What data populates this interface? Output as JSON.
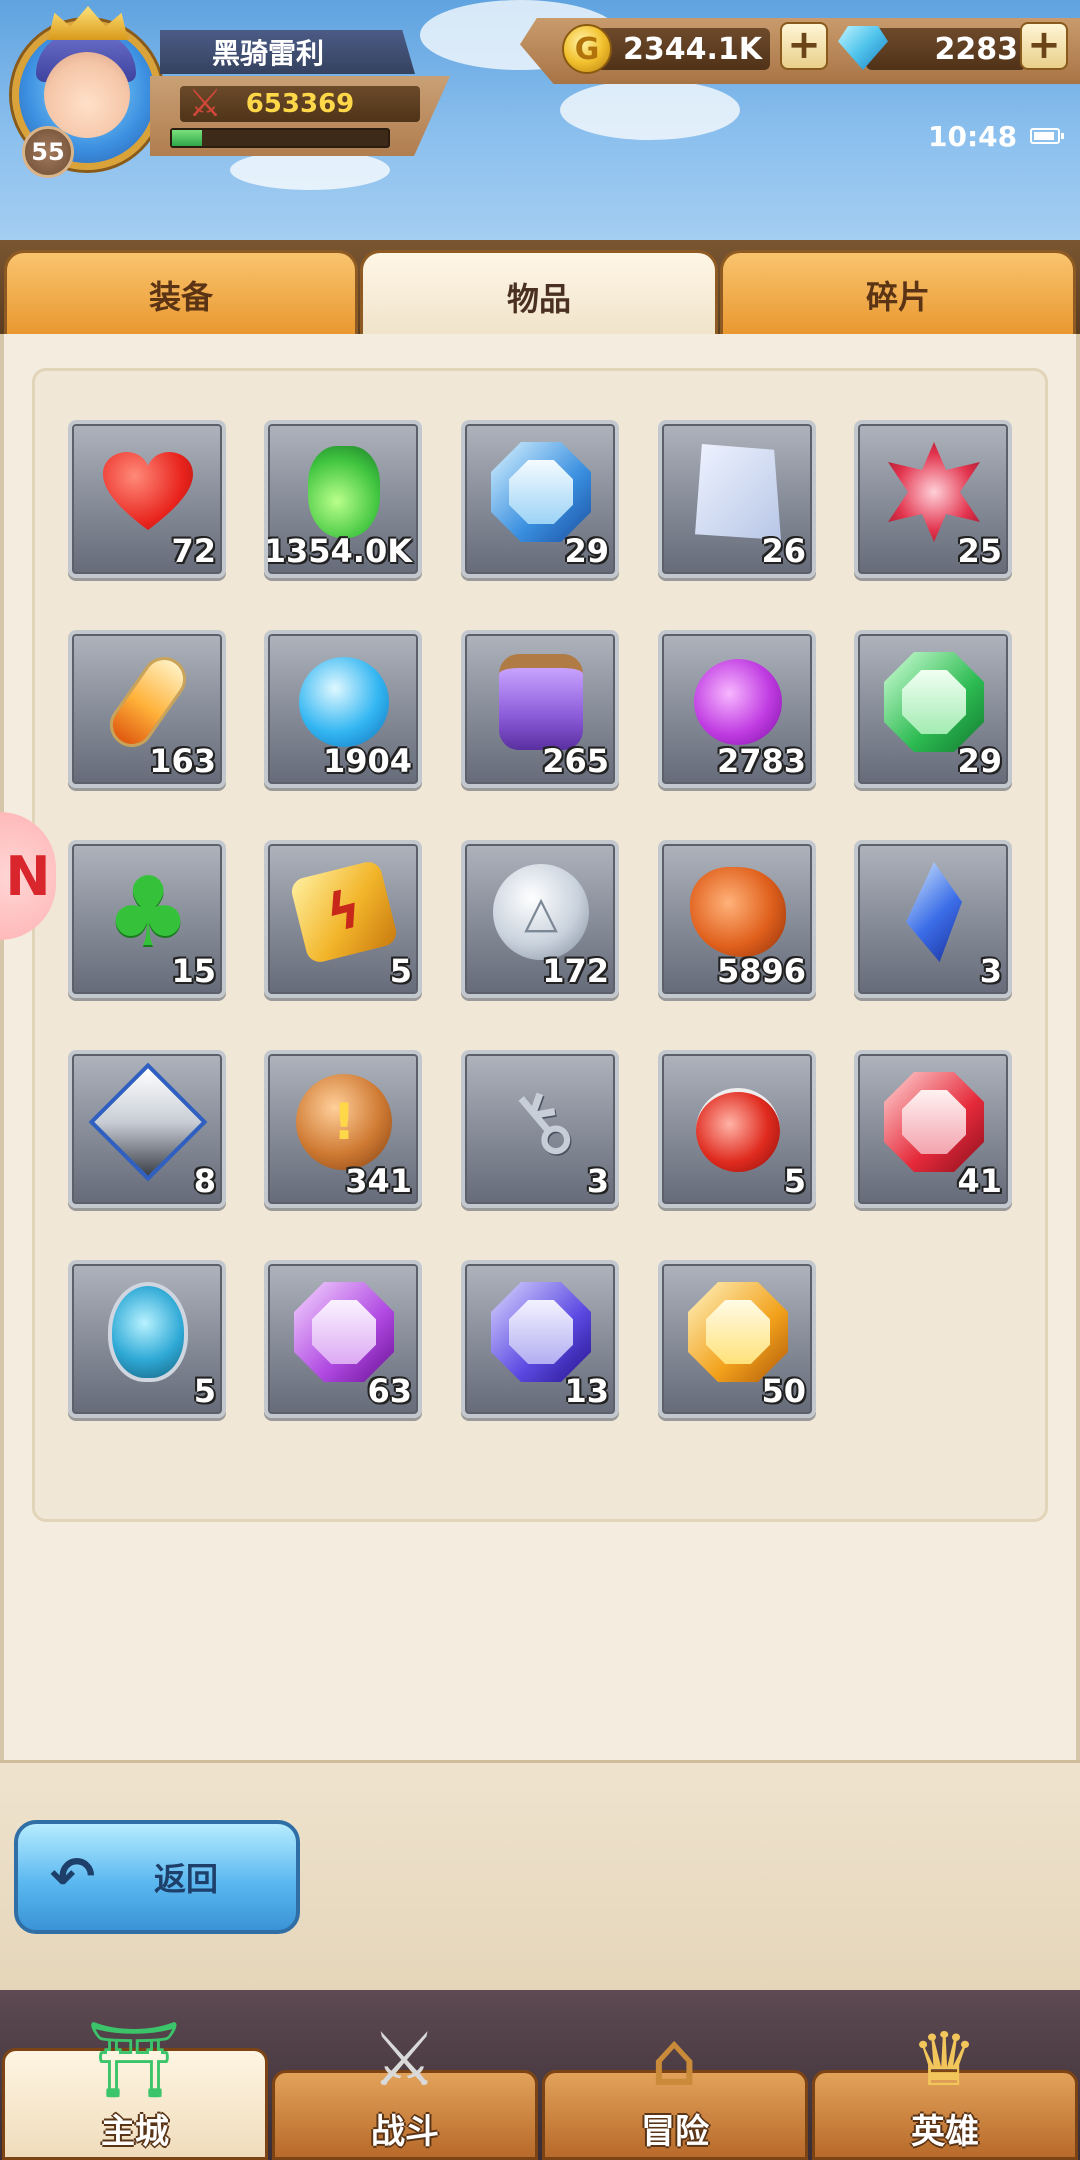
{
  "player": {
    "name": "黑骑雷利",
    "level": "55",
    "power": "653369",
    "exp_progress": 0.14
  },
  "resources": {
    "gold": "2344.1K",
    "gems": "2283"
  },
  "status_bar": {
    "time": "10:48"
  },
  "tabs": [
    {
      "label": "装备",
      "active": false
    },
    {
      "label": "物品",
      "active": true
    },
    {
      "label": "碎片",
      "active": false
    }
  ],
  "items": [
    {
      "icon": "heart-icon",
      "count": "72"
    },
    {
      "icon": "green-potion-icon",
      "count": "1354.0K"
    },
    {
      "icon": "blue-shield-gem-icon",
      "count": "29"
    },
    {
      "icon": "scroll-icon",
      "count": "26"
    },
    {
      "icon": "red-star-gem-icon",
      "count": "25"
    },
    {
      "icon": "orange-vial-icon",
      "count": "163"
    },
    {
      "icon": "blue-orb-icon",
      "count": "1904"
    },
    {
      "icon": "purple-jar-icon",
      "count": "265"
    },
    {
      "icon": "purple-flask-icon",
      "count": "2783"
    },
    {
      "icon": "green-glove-gem-icon",
      "count": "29"
    },
    {
      "icon": "clover-icon",
      "count": "15"
    },
    {
      "icon": "lightning-stone-icon",
      "count": "5"
    },
    {
      "icon": "silver-coin-icon",
      "count": "172"
    },
    {
      "icon": "orange-ore-icon",
      "count": "5896"
    },
    {
      "icon": "blue-crystal-icon",
      "count": "3"
    },
    {
      "icon": "cube-icon",
      "count": "8"
    },
    {
      "icon": "bronze-coin-icon",
      "count": "341"
    },
    {
      "icon": "key-icon",
      "count": "3"
    },
    {
      "icon": "red-potion-icon",
      "count": "5"
    },
    {
      "icon": "red-sword-gem-icon",
      "count": "41"
    },
    {
      "icon": "blue-egg-icon",
      "count": "5"
    },
    {
      "icon": "purple-helmet-gem-icon",
      "count": "63"
    },
    {
      "icon": "indigo-boots-gem-icon",
      "count": "13"
    },
    {
      "icon": "gold-armor-gem-icon",
      "count": "50"
    }
  ],
  "back_button": {
    "label": "返回"
  },
  "bottom_nav": [
    {
      "label": "主城",
      "icon": "castle-icon",
      "active": true
    },
    {
      "label": "战斗",
      "icon": "crossed-swords-icon",
      "active": false
    },
    {
      "label": "冒险",
      "icon": "map-icon",
      "active": false
    },
    {
      "label": "英雄",
      "icon": "hero-crest-icon",
      "active": false
    }
  ],
  "colors": {
    "tab_active": "#efe2c8",
    "tab_inactive": "#e9972f",
    "back_button": "#5bb8f0",
    "count_text": "#ffffff",
    "power_text": "#ffd84a"
  }
}
